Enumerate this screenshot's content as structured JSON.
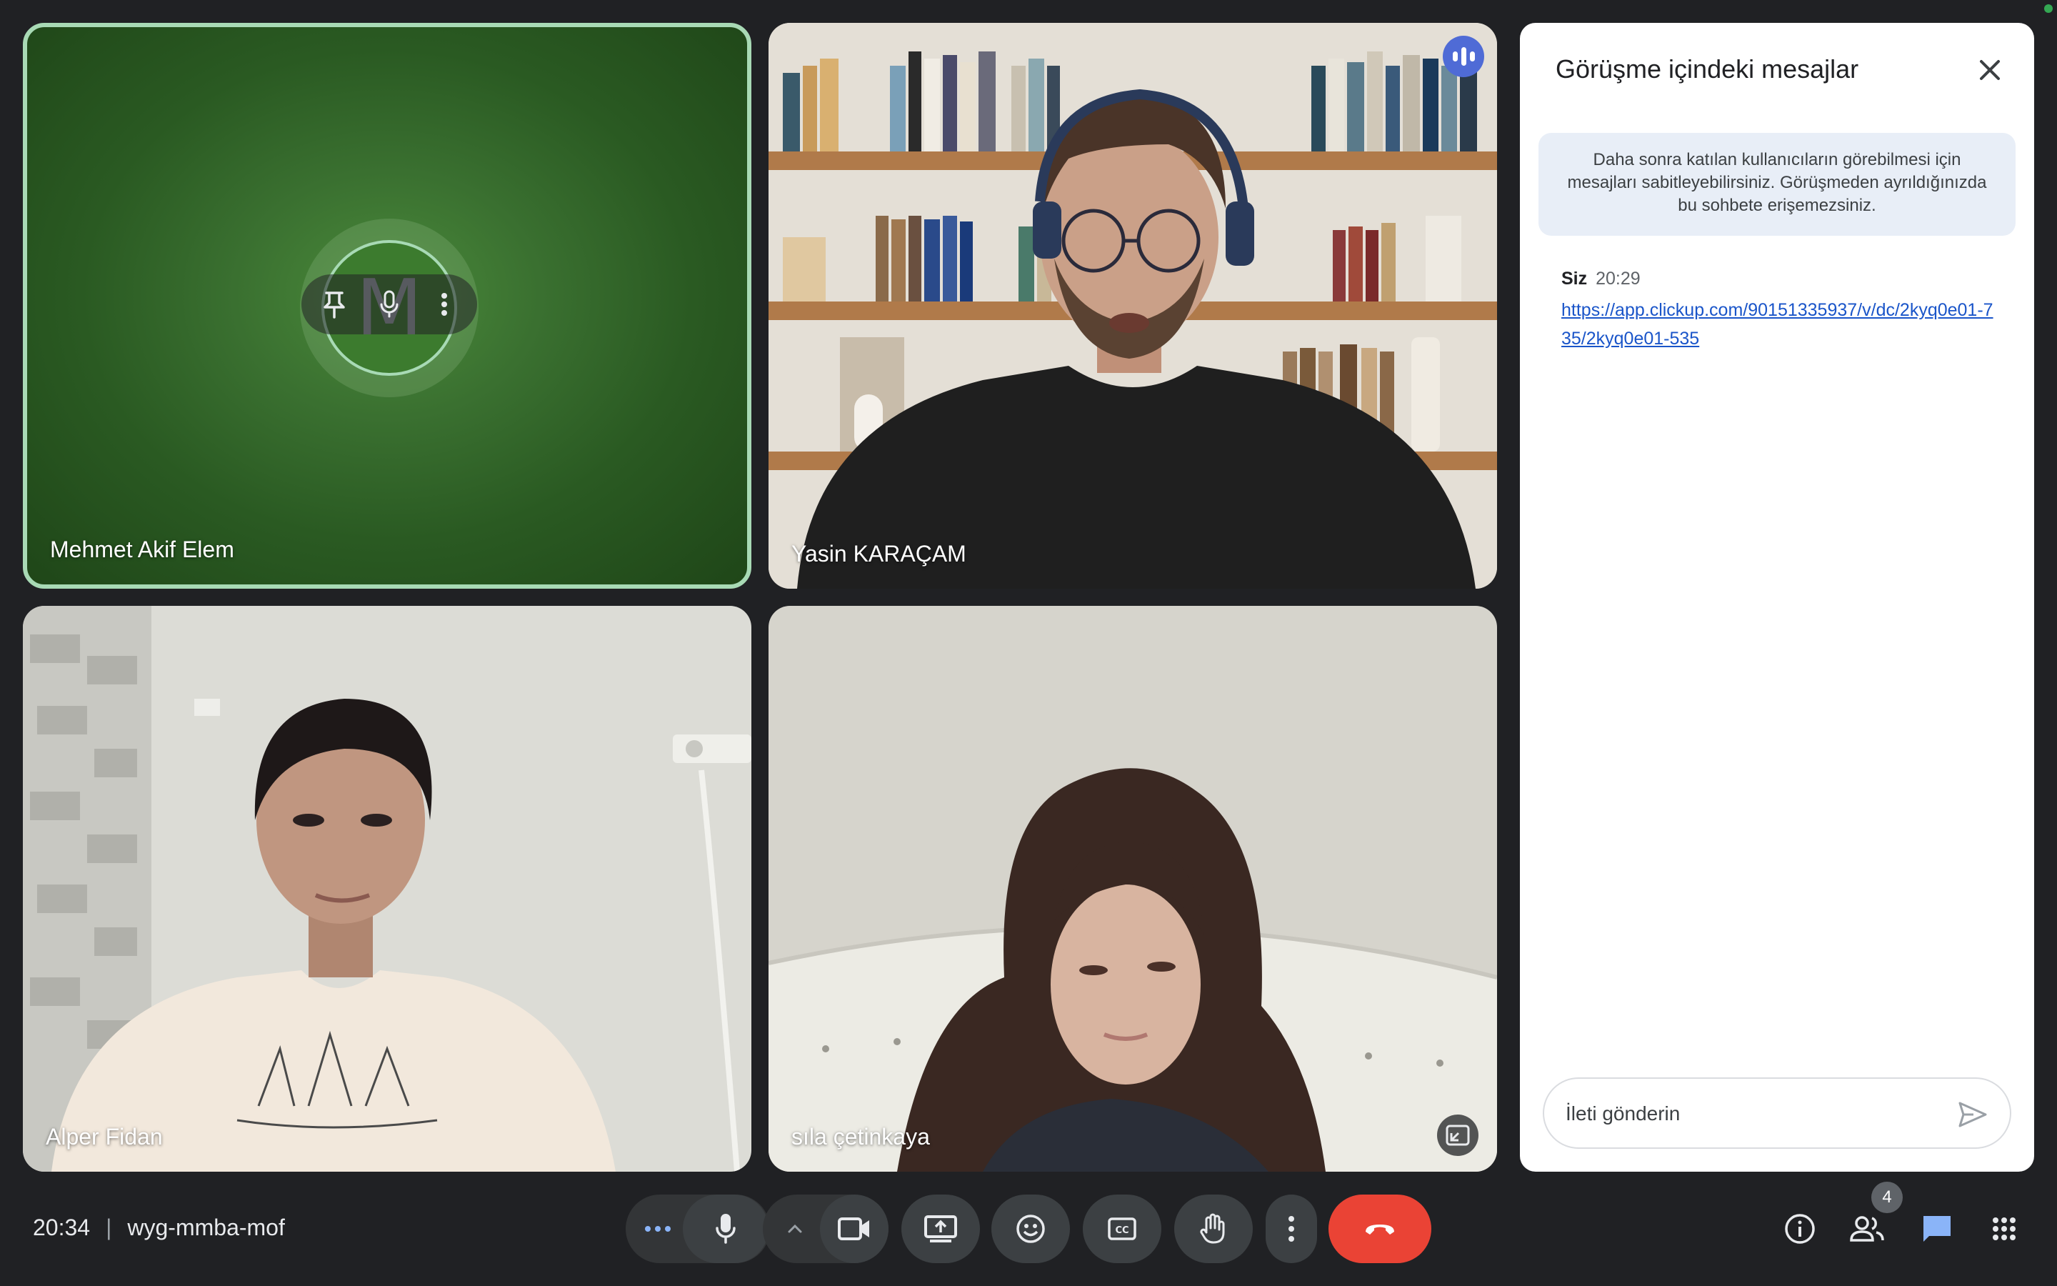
{
  "participants": [
    {
      "name": "Mehmet Akif Elem",
      "initial": "M",
      "camera_on": false
    },
    {
      "name": "Yasin KARAÇAM",
      "camera_on": true,
      "speaking": true
    },
    {
      "name": "Alper Fidan",
      "camera_on": true
    },
    {
      "name": "sıla çetinkaya",
      "camera_on": true
    }
  ],
  "chat": {
    "title": "Görüşme içindeki mesajlar",
    "info": "Daha sonra katılan kullanıcıların görebilmesi için mesajları sabitleyebilirsiniz. Görüşmeden ayrıldığınızda bu sohbete erişemezsiniz.",
    "messages": [
      {
        "sender": "Siz",
        "time": "20:29",
        "text": "https://app.clickup.com/90151335937/v/dc/2kyq0e01-735/2kyq0e01-535"
      }
    ],
    "input_placeholder": "İleti gönderin"
  },
  "meeting": {
    "time": "20:34",
    "code": "wyg-mmba-mof"
  },
  "people_count": "4",
  "colors": {
    "accent": "#a8dab5",
    "end_call": "#ea4335",
    "chat_link": "#1a55c9",
    "speaking": "#4f6bd6"
  },
  "icons": [
    "more-options-icon",
    "microphone-icon",
    "chevron-up-icon",
    "camera-icon",
    "present-screen-icon",
    "emoji-icon",
    "captions-icon",
    "raise-hand-icon",
    "more-vert-icon",
    "end-call-icon",
    "info-icon",
    "people-icon",
    "chat-icon",
    "apps-icon",
    "pin-icon",
    "mic-off-icon",
    "speaking-icon",
    "expand-icon",
    "close-icon",
    "send-icon"
  ]
}
